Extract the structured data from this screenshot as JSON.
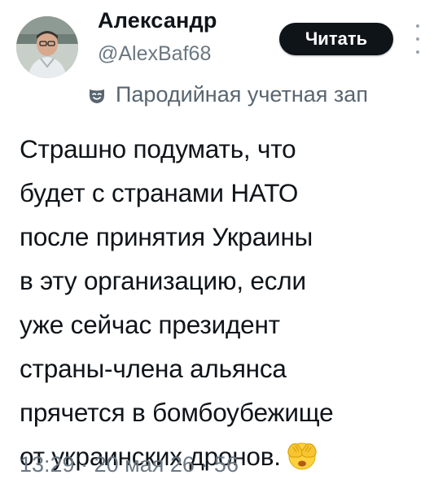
{
  "author": {
    "name": "Александр",
    "handle": "@AlexBaf68",
    "avatar_icon": "user-avatar-photo"
  },
  "follow_button": {
    "label": "Читать"
  },
  "parody_label": {
    "icon": "parody-mask-icon",
    "text": "Пародийная учетная зап"
  },
  "tweet": {
    "lines": [
      "Страшно подумать, что",
      "будет с странами НАТО",
      "после принятия Украины",
      "в эту организацию, если",
      "уже сейчас президент",
      "страны-члена альянса",
      "прячется в бомбоубежище",
      "от украинских дронов."
    ],
    "emoji": "face-with-hand-over-eyes-emoji"
  },
  "meta": {
    "time": "13:29",
    "date": "20 мая 26",
    "views": "56",
    "separator": "·"
  },
  "colors": {
    "text": "#0f1419",
    "secondary": "#6b7781",
    "button_bg": "#0f1419",
    "button_text": "#ffffff"
  }
}
